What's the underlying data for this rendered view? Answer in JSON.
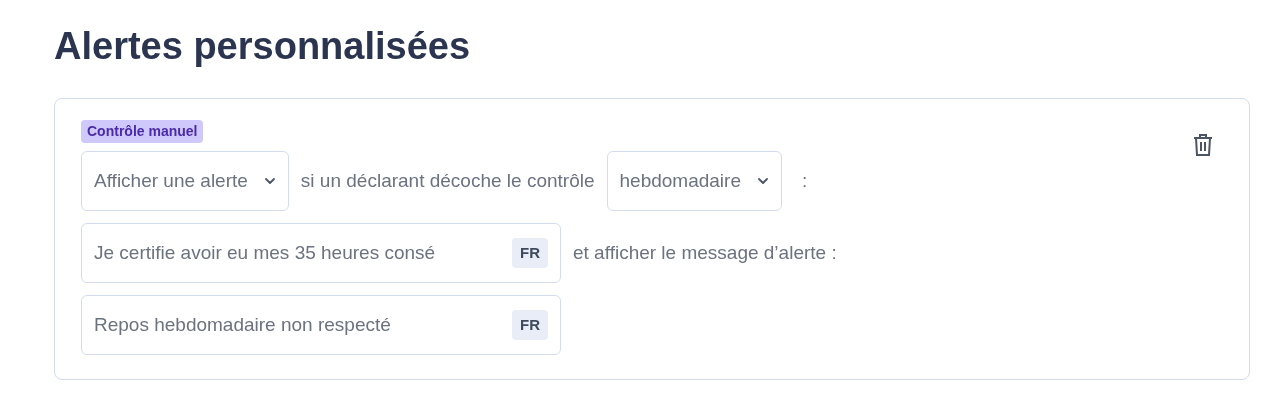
{
  "title": "Alertes personnalisées",
  "alert": {
    "tag": "Contrôle manuel",
    "action_select": {
      "value": "Afficher une alerte"
    },
    "text_1": "si un déclarant décoche le contrôle",
    "period_select": {
      "value": "hebdomadaire"
    },
    "text_2": ":",
    "control_field": {
      "value": "Je certifie avoir eu mes 35 heures consé",
      "lang": "FR"
    },
    "text_3": "et afficher le message d’alerte :",
    "message_field": {
      "value": "Repos hebdomadaire non respecté",
      "lang": "FR"
    }
  }
}
